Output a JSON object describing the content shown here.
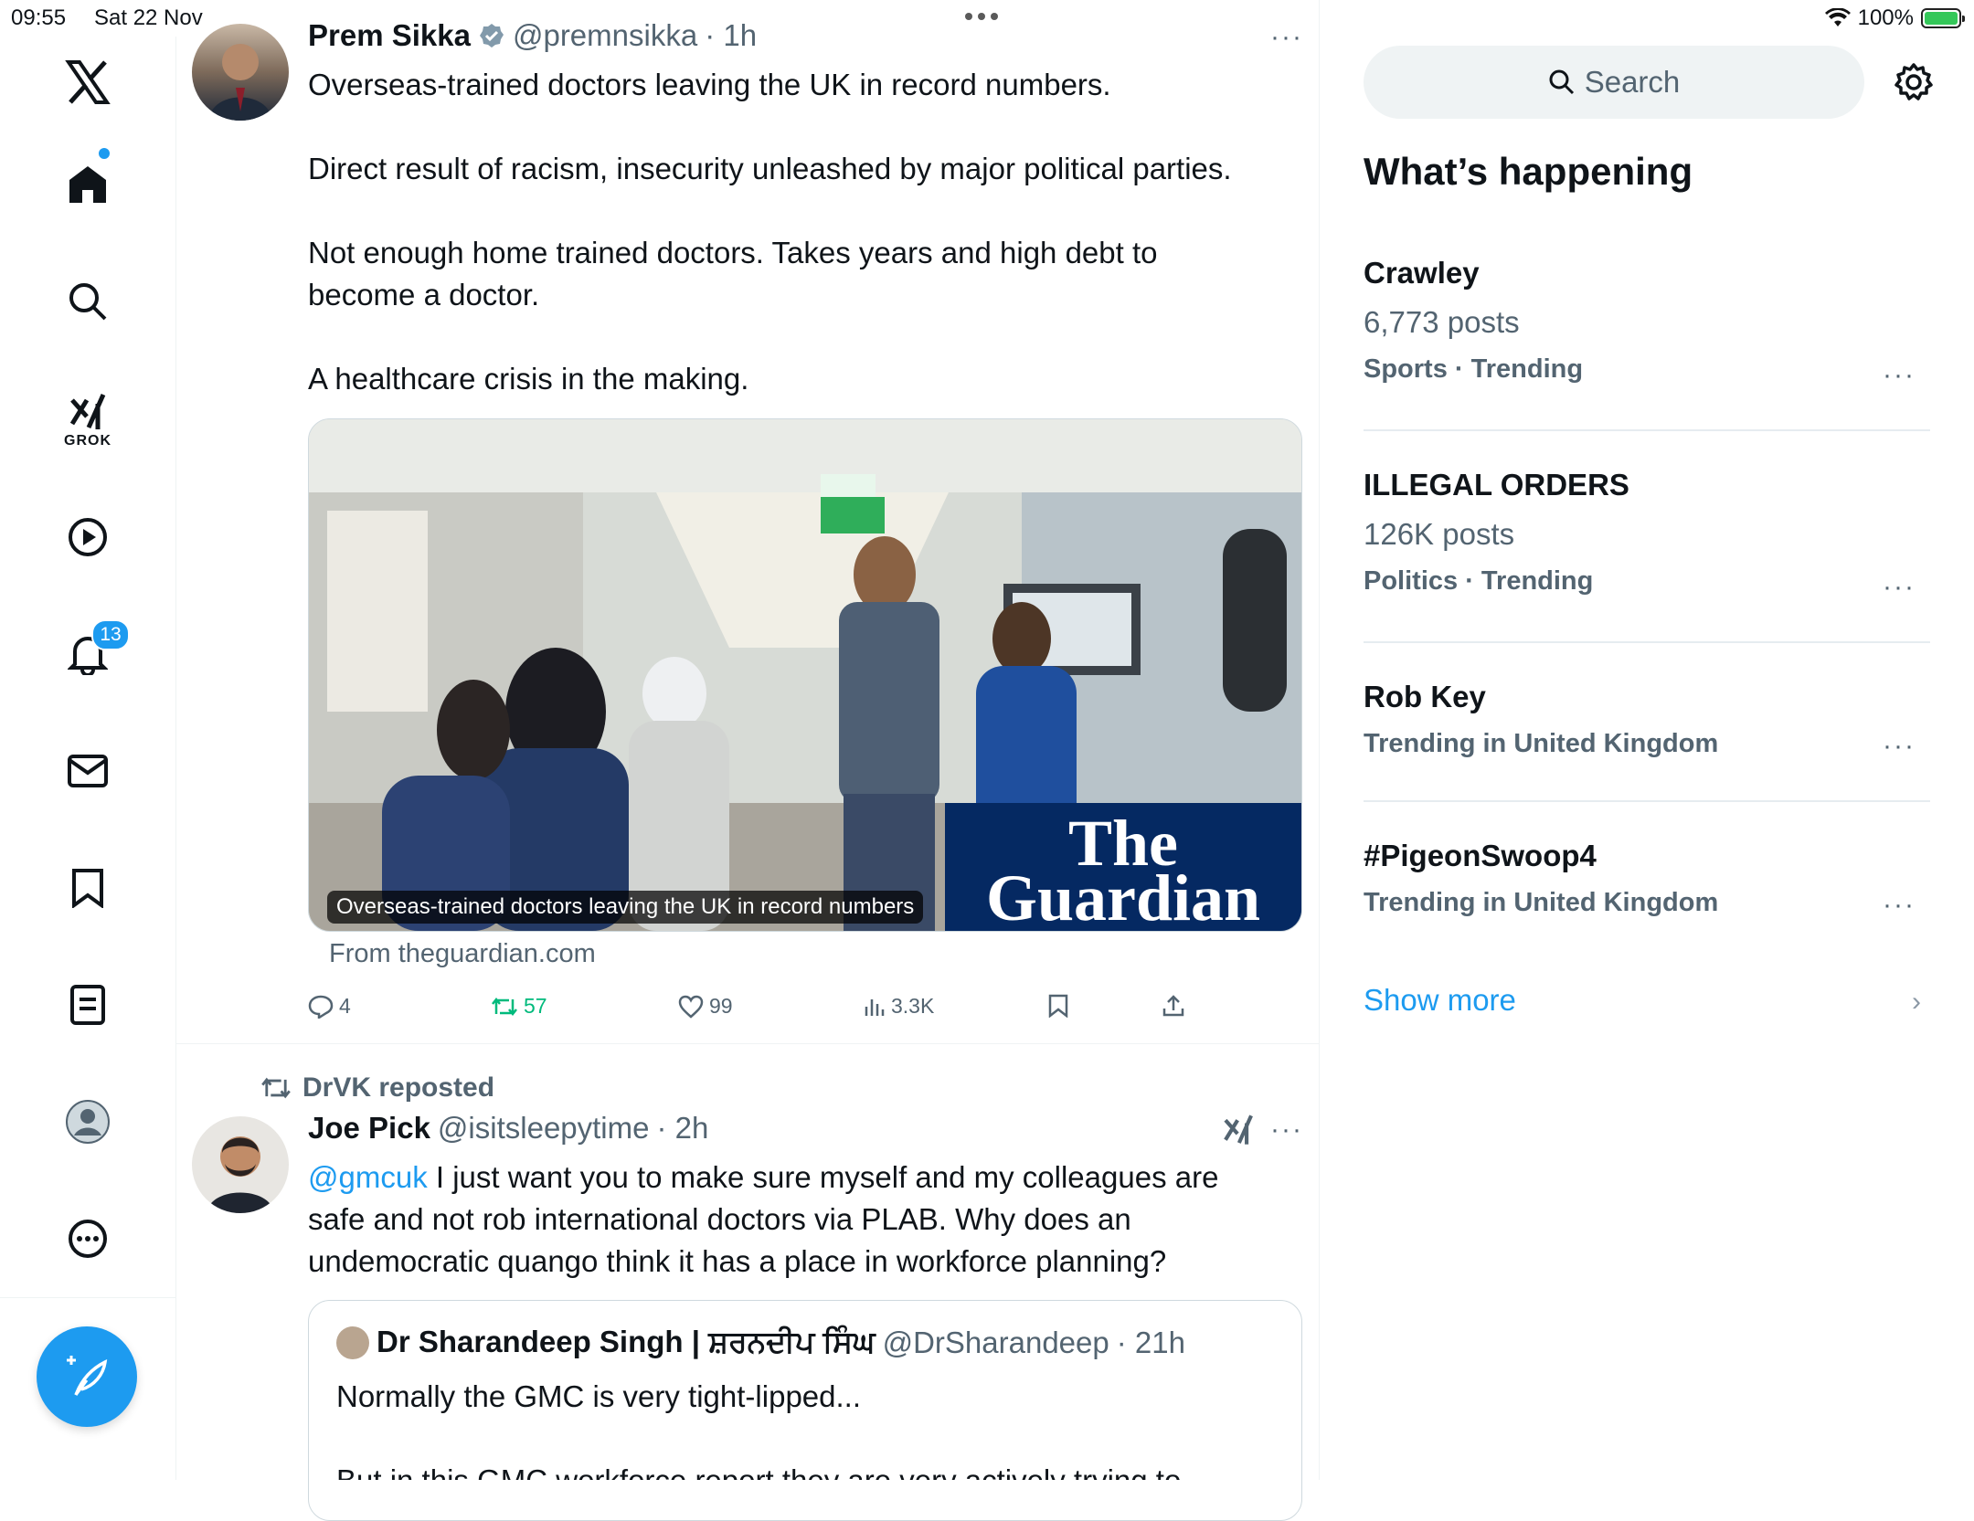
{
  "status": {
    "time": "09:55",
    "date": "Sat 22 Nov",
    "battery": "100%"
  },
  "sidebar": {
    "grok_label": "GROK",
    "notifications_count": "13"
  },
  "tweet1": {
    "name": "Prem Sikka",
    "handle": "@premnsikka",
    "time": "· 1h",
    "line1": "Overseas-trained doctors leaving the UK in record numbers.",
    "line2": "Direct result of racism, insecurity unleashed by major political parties.",
    "line3a": "Not enough home trained doctors. Takes years and high debt to",
    "line3b": "become a doctor.",
    "line4": "A healthcare crisis in the making.",
    "media_caption": "Overseas-trained doctors leaving the UK in record numbers",
    "media_logo_line1": "The",
    "media_logo_line2": "Guardian",
    "source": "From theguardian.com",
    "replies": "4",
    "reposts": "57",
    "likes": "99",
    "views": "3.3K"
  },
  "tweet2": {
    "repost_label": "DrVK reposted",
    "name": "Joe Pick",
    "handle": "@isitsleepytime",
    "time": "· 2h",
    "mention": "@gmcuk",
    "text1": " I just want you to make sure myself and my colleagues are",
    "text2": "safe and not rob international doctors via PLAB. Why does an",
    "text3": "undemocratic quango think it has a place in workforce planning?",
    "quote_name": "Dr Sharandeep Singh | ਸ਼ਰਨਦੀਪ ਸਿੰਘ",
    "quote_handle": "@DrSharandeep",
    "quote_time": "· 21h",
    "quote_text": "Normally the GMC is very tight-lipped...",
    "quote_text2": "But in this GMC workforce report they are very actively trying to"
  },
  "right": {
    "search_placeholder": "Search",
    "whats_happening": "What’s happening",
    "trends": [
      {
        "name": "Crawley",
        "posts": "6,773 posts",
        "meta": "Sports · Trending"
      },
      {
        "name": "ILLEGAL ORDERS",
        "posts": "126K posts",
        "meta": "Politics · Trending"
      },
      {
        "name": "Rob Key",
        "posts": "",
        "meta": "Trending in United Kingdom"
      },
      {
        "name": "#PigeonSwoop4",
        "posts": "",
        "meta": "Trending in United Kingdom"
      }
    ],
    "show_more": "Show more"
  },
  "colors": {
    "accent": "#1d9bf0",
    "repost_green": "#00ba7c",
    "guardian_blue": "#052962"
  }
}
